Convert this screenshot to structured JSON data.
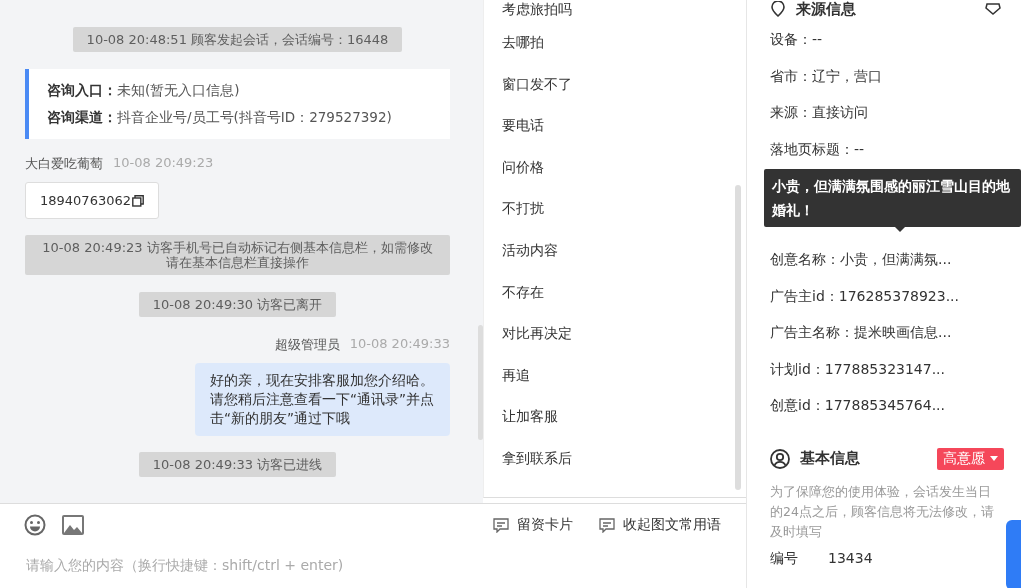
{
  "chat": {
    "messages": [
      {
        "kind": "system",
        "text": "10-08 20:48:51 顾客发起会话，会话编号：16448"
      },
      {
        "kind": "entry",
        "rows": [
          {
            "label": "咨询入口：",
            "value": "未知(暂无入口信息)"
          },
          {
            "label": "咨询渠道：",
            "value": "抖音企业号/员工号(抖音号ID：279527392)"
          }
        ]
      },
      {
        "kind": "visitor",
        "sender": "大白爱吃葡萄",
        "time": "10-08 20:49:23",
        "phone": "18940763062"
      },
      {
        "kind": "system",
        "text": "10-08 20:49:23 访客手机号已自动标记右侧基本信息栏，如需修改请在基本信息栏直接操作"
      },
      {
        "kind": "system",
        "text": "10-08 20:49:30 访客已离开"
      },
      {
        "kind": "agent",
        "sender": "超级管理员",
        "time": "10-08 20:49:33",
        "text": "好的亲，现在安排客服加您介绍哈。请您稍后注意查看一下“通讯录”并点击“新的朋友”通过下哦"
      },
      {
        "kind": "system",
        "text": "10-08 20:49:33 访客已进线"
      }
    ]
  },
  "composer": {
    "placeholder": "请输入您的内容（换行快捷键：shift/ctrl + enter)",
    "actions": [
      {
        "label": "留资卡片"
      },
      {
        "label": "收起图文常用语"
      }
    ]
  },
  "phrases": [
    "考虑旅拍吗",
    "去哪拍",
    "窗口发不了",
    "要电话",
    "问价格",
    "不打扰",
    "活动内容",
    "不存在",
    "对比再决定",
    "再追",
    "让加客服",
    "拿到联系后"
  ],
  "source": {
    "title": "来源信息",
    "rows": [
      {
        "kind": "row",
        "text": "设备：--"
      },
      {
        "kind": "row",
        "text": "省市：辽宁，营口"
      },
      {
        "kind": "row",
        "text": "来源：直接访问"
      },
      {
        "kind": "row",
        "text": "落地页标题：--"
      },
      {
        "kind": "tooltip",
        "text": "小贵，但满满氛围感的丽江雪山目的地婚礼！"
      },
      {
        "kind": "row",
        "text": "创意名称：小贵，但满满氛..."
      },
      {
        "kind": "row",
        "text": "广告主id：176285378923..."
      },
      {
        "kind": "row",
        "text": "广告主名称：提米映画信息..."
      },
      {
        "kind": "row",
        "text": "计划id：177885323147..."
      },
      {
        "kind": "row",
        "text": "创意id：177885345764..."
      }
    ]
  },
  "basic": {
    "title": "基本信息",
    "intent": "高意愿",
    "notice": "为了保障您的使用体验，会话发生当日的24点之后，顾客信息将无法修改，请及时填写",
    "fields": [
      {
        "label": "编号",
        "value": "13434"
      }
    ]
  }
}
